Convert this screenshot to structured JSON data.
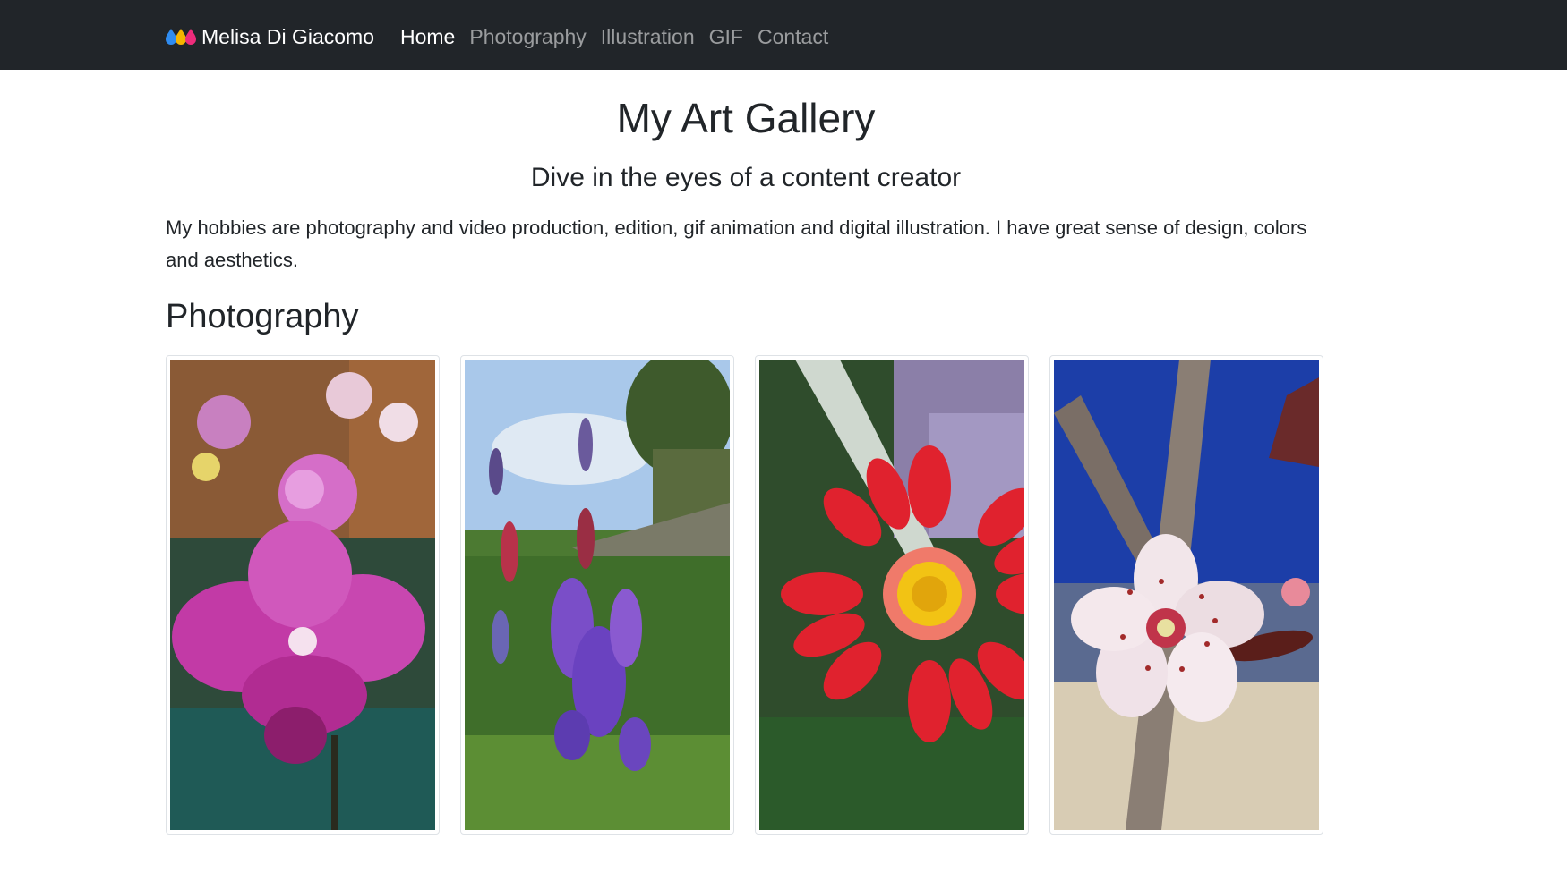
{
  "navbar": {
    "brand": "Melisa Di Giacomo",
    "logo_icon": "droplets-logo-icon",
    "logo_colors": [
      "#2f8cf0",
      "#f5b400",
      "#ee2c7b"
    ],
    "links": [
      {
        "label": "Home",
        "active": true
      },
      {
        "label": "Photography",
        "active": false
      },
      {
        "label": "Illustration",
        "active": false
      },
      {
        "label": "GIF",
        "active": false
      },
      {
        "label": "Contact",
        "active": false
      }
    ]
  },
  "main": {
    "title": "My Art Gallery",
    "subtitle": "Dive in the eyes of a content creator",
    "intro": "My hobbies are photography and video production, edition, gif animation and digital illustration. I have great sense of design, colors and aesthetics.",
    "photography": {
      "heading": "Photography",
      "photos": [
        {
          "subject": "pink orchid"
        },
        {
          "subject": "purple lupine flowers"
        },
        {
          "subject": "red daisy flower"
        },
        {
          "subject": "white plum blossom"
        }
      ]
    }
  },
  "colors": {
    "navbar_bg": "#212529",
    "text": "#212529",
    "nav_active": "#ffffff",
    "nav_inactive": "rgba(255,255,255,0.55)"
  }
}
